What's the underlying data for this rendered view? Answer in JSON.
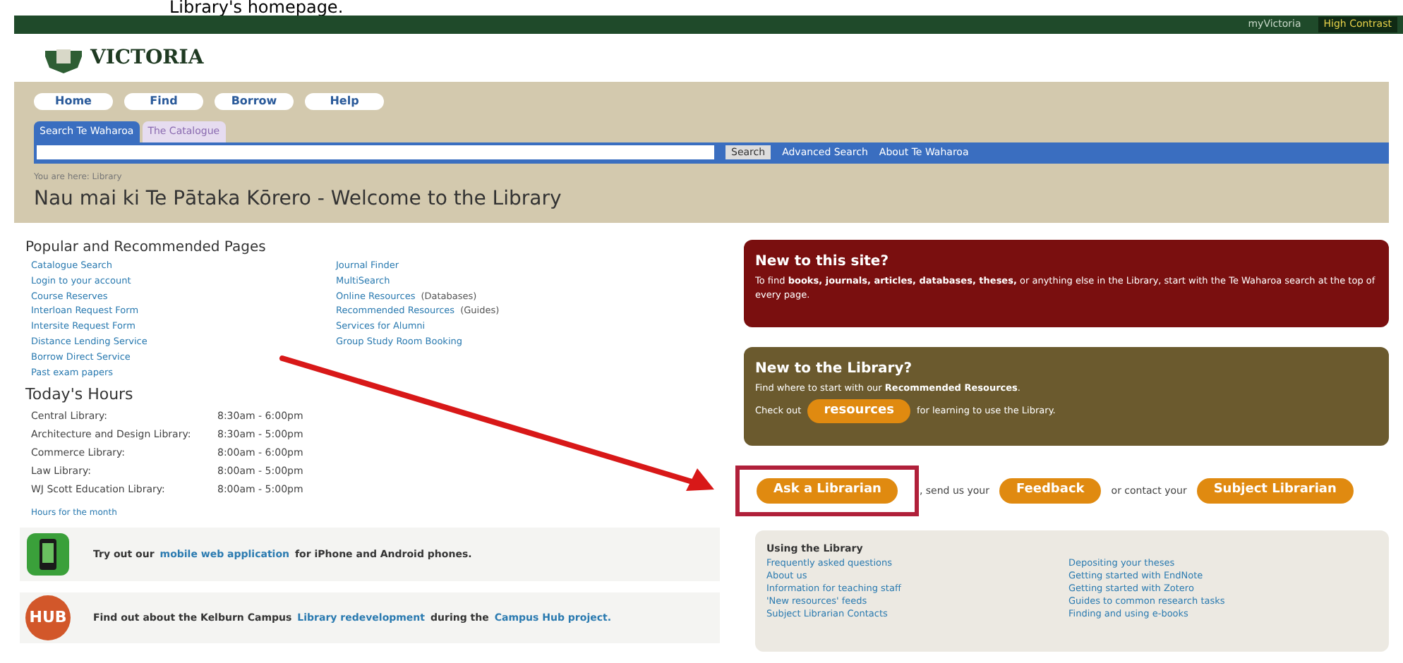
{
  "caption": "Library's homepage.",
  "top_bar": {
    "links": [
      {
        "text": "myVictoria",
        "highlight": false
      },
      {
        "text": "High Contrast",
        "highlight": true
      }
    ]
  },
  "logo": {
    "text": "VICTORIA"
  },
  "nav": [
    {
      "label": "Home"
    },
    {
      "label": "Find"
    },
    {
      "label": "Borrow"
    },
    {
      "label": "Help"
    }
  ],
  "search_tabs": [
    {
      "label": "Search Te Waharoa",
      "selected": true
    },
    {
      "label": "The Catalogue",
      "selected": false
    }
  ],
  "search": {
    "button": "Search",
    "links": [
      "Advanced Search",
      "About Te Waharoa"
    ]
  },
  "breadcrumb": "You are here: Library",
  "page_title": "Nau mai ki Te Pātaka Kōrero - Welcome to the Library",
  "popular": {
    "heading": "Popular and Recommended Pages",
    "columns": [
      [
        {
          "text": "Catalogue Search"
        },
        {
          "text": "Login to your account"
        },
        {
          "text": "Course Reserves"
        },
        {
          "text": "Interloan Request Form"
        },
        {
          "text": "Intersite Request Form"
        },
        {
          "text": "Distance Lending Service"
        },
        {
          "text": "Borrow Direct Service"
        },
        {
          "text": "Past exam papers"
        }
      ],
      [
        {
          "text": "Journal Finder"
        },
        {
          "text": "MultiSearch"
        },
        {
          "text": "Online Resources",
          "note": "(Databases)"
        },
        {
          "text": "Recommended Resources",
          "note": "(Guides)"
        },
        {
          "text": "Services for Alumni"
        },
        {
          "text": "Group Study Room Booking"
        }
      ]
    ]
  },
  "hours": {
    "heading": "Today's Hours",
    "rows": [
      {
        "library": "Central Library:",
        "time": "8:30am - 6:00pm"
      },
      {
        "library": "Architecture and Design Library:",
        "time": "8:30am - 5:00pm"
      },
      {
        "library": "Commerce Library:",
        "time": "8:00am - 6:00pm"
      },
      {
        "library": "Law Library:",
        "time": "8:00am - 5:00pm"
      },
      {
        "library": "WJ Scott Education Library:",
        "time": "8:00am - 5:00pm"
      }
    ],
    "month_link": "Hours for the month"
  },
  "promos": [
    {
      "kind": "phone",
      "parts": [
        {
          "kind": "text",
          "text": "Try out our"
        },
        {
          "kind": "link",
          "text": "mobile web application"
        },
        {
          "kind": "text",
          "text": "for iPhone and Android phones."
        }
      ]
    },
    {
      "kind": "hub",
      "icon_text": "HUB",
      "parts": [
        {
          "kind": "text",
          "text": "Find out about the Kelburn Campus"
        },
        {
          "kind": "link",
          "text": "Library redevelopment"
        },
        {
          "kind": "text",
          "text": "during the"
        },
        {
          "kind": "link",
          "text": "Campus Hub project."
        }
      ]
    }
  ],
  "info_boxes": [
    {
      "color": "#7a0f0f",
      "title": "New to this site?",
      "lines": [
        [
          {
            "kind": "text",
            "text": "To find **books, journals, articles, databases, theses,** or anything else in the Library, start with the Te Waharoa search at the top of every page."
          }
        ]
      ]
    },
    {
      "color": "#6b5a2e",
      "title": "New to the Library?",
      "lines": [
        [
          {
            "kind": "text",
            "text": "Find where to start with our **Recommended Resources**."
          }
        ],
        [
          {
            "kind": "text",
            "text": "Check out"
          },
          {
            "kind": "button",
            "text": "resources"
          },
          {
            "kind": "text",
            "text": "for learning to use the Library."
          }
        ]
      ]
    }
  ],
  "contact_row": [
    {
      "kind": "button",
      "text": "Ask a Librarian",
      "highlighted": true
    },
    {
      "kind": "text",
      "text": ", send us your"
    },
    {
      "kind": "button",
      "text": "Feedback",
      "highlighted": false
    },
    {
      "kind": "text",
      "text": "or contact your"
    },
    {
      "kind": "button",
      "text": "Subject Librarian",
      "highlighted": false
    }
  ],
  "using": {
    "heading": "Using the Library",
    "columns": [
      [
        "Frequently asked questions",
        "About us",
        "Information for teaching staff",
        "'New resources' feeds",
        "Subject Librarian Contacts"
      ],
      [
        "Depositing your theses",
        "Getting started with EndNote",
        "Getting started with Zotero",
        "Guides to common research tasks",
        "Finding and using e-books"
      ]
    ]
  }
}
